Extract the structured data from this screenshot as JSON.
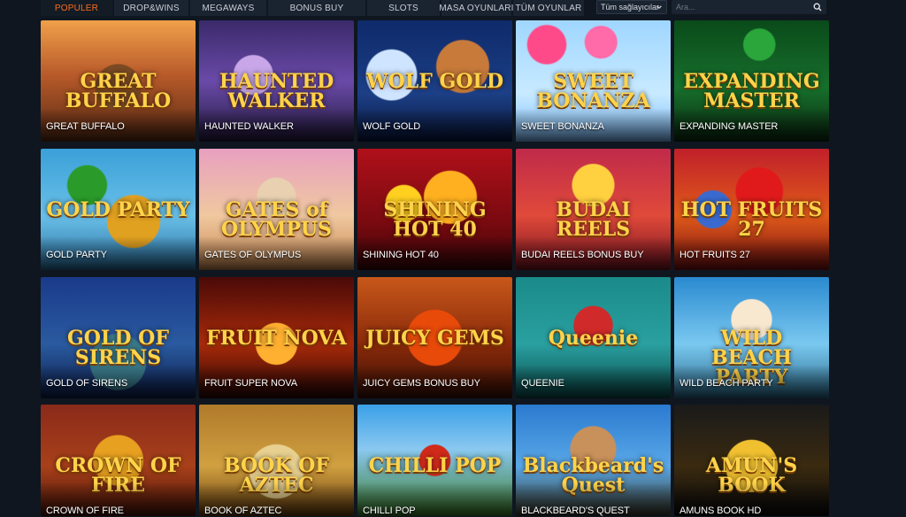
{
  "tabs": [
    {
      "label": "Populer",
      "active": true
    },
    {
      "label": "Drop&Wins",
      "active": false
    },
    {
      "label": "Megaways",
      "active": false
    },
    {
      "label": "Bonus Buy",
      "active": false
    },
    {
      "label": "Slots",
      "active": false
    },
    {
      "label": "Masa Oyunlari",
      "active": false
    },
    {
      "label": "Tüm Oyunlar",
      "active": false
    }
  ],
  "provider_select": {
    "selected": "Tüm sağlayıcılar",
    "icon": "chevron-down-icon"
  },
  "search": {
    "placeholder": "Ara...",
    "value": "",
    "icon": "search-icon"
  },
  "games": [
    {
      "name": "GREAT BUFFALO",
      "logo": "GREAT BUFFALO"
    },
    {
      "name": "HAUNTED WALKER",
      "logo": "HAUNTED WALKER"
    },
    {
      "name": "WOLF GOLD",
      "logo": "WOLF GOLD"
    },
    {
      "name": "SWEET BONANZA",
      "logo": "SWEET BONANZA"
    },
    {
      "name": "EXPANDING MASTER",
      "logo": "EXPANDING MASTER"
    },
    {
      "name": "GOLD PARTY",
      "logo": "GOLD PARTY"
    },
    {
      "name": "GATES OF OLYMPUS",
      "logo": "GATES of OLYMPUS"
    },
    {
      "name": "SHINING HOT 40",
      "logo": "SHINING HOT 40"
    },
    {
      "name": "BUDAI REELS BONUS BUY",
      "logo": "BUDAI REELS"
    },
    {
      "name": "HOT FRUITS 27",
      "logo": "HOT FRUITS 27"
    },
    {
      "name": "GOLD OF SIRENS",
      "logo": "GOLD OF SIRENS"
    },
    {
      "name": "FRUIT SUPER NOVA",
      "logo": "FRUIT NOVA"
    },
    {
      "name": "JUICY GEMS BONUS BUY",
      "logo": "JUICY GEMS"
    },
    {
      "name": "QUEENIE",
      "logo": "Queenie"
    },
    {
      "name": "WILD BEACH PARTY",
      "logo": "WILD BEACH PARTY"
    },
    {
      "name": "CROWN OF FIRE",
      "logo": "CROWN OF FIRE"
    },
    {
      "name": "BOOK OF AZTEC",
      "logo": "BOOK OF AZTEC"
    },
    {
      "name": "CHILLI POP",
      "logo": "CHILLI POP"
    },
    {
      "name": "BLACKBEARD'S QUEST",
      "logo": "Blackbeard's Quest"
    },
    {
      "name": "AMUNS BOOK HD",
      "logo": "AMUN'S BOOK"
    }
  ]
}
